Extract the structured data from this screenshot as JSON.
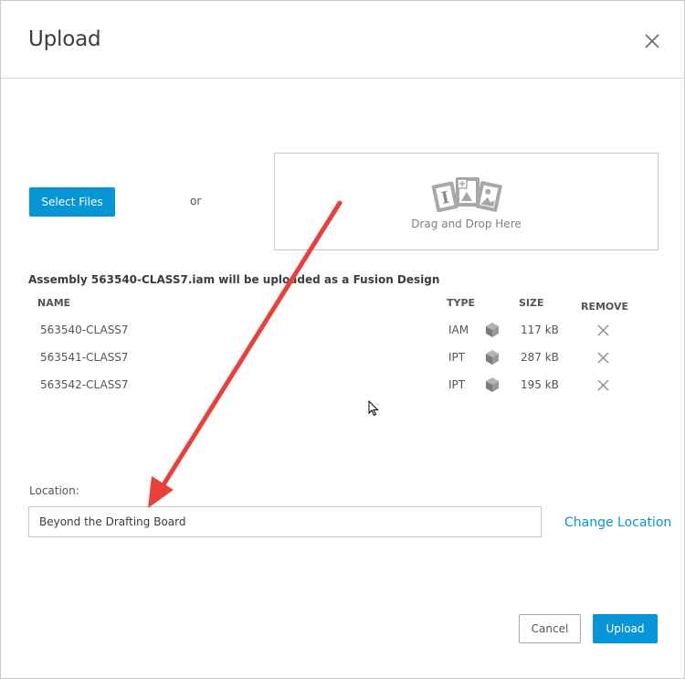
{
  "dialog": {
    "title": "Upload"
  },
  "select_files_label": "Select Files",
  "or_label": "or",
  "dropzone": {
    "label": "Drag and Drop Here"
  },
  "assembly_message": "Assembly 563540-CLASS7.iam will be uploaded as a Fusion Design",
  "table": {
    "columns": {
      "name": "NAME",
      "type": "TYPE",
      "size": "SIZE",
      "remove": "REMOVE"
    },
    "rows": [
      {
        "name": "563540-CLASS7",
        "type": "IAM",
        "size": "117 kB"
      },
      {
        "name": "563541-CLASS7",
        "type": "IPT",
        "size": "287 kB"
      },
      {
        "name": "563542-CLASS7",
        "type": "IPT",
        "size": "195 kB"
      }
    ]
  },
  "location": {
    "label": "Location:",
    "value": "Beyond the Drafting Board",
    "change_label": "Change Location"
  },
  "footer": {
    "cancel_label": "Cancel",
    "upload_label": "Upload"
  },
  "colors": {
    "accent": "#0696d7",
    "annotation_arrow": "#e8413b"
  }
}
